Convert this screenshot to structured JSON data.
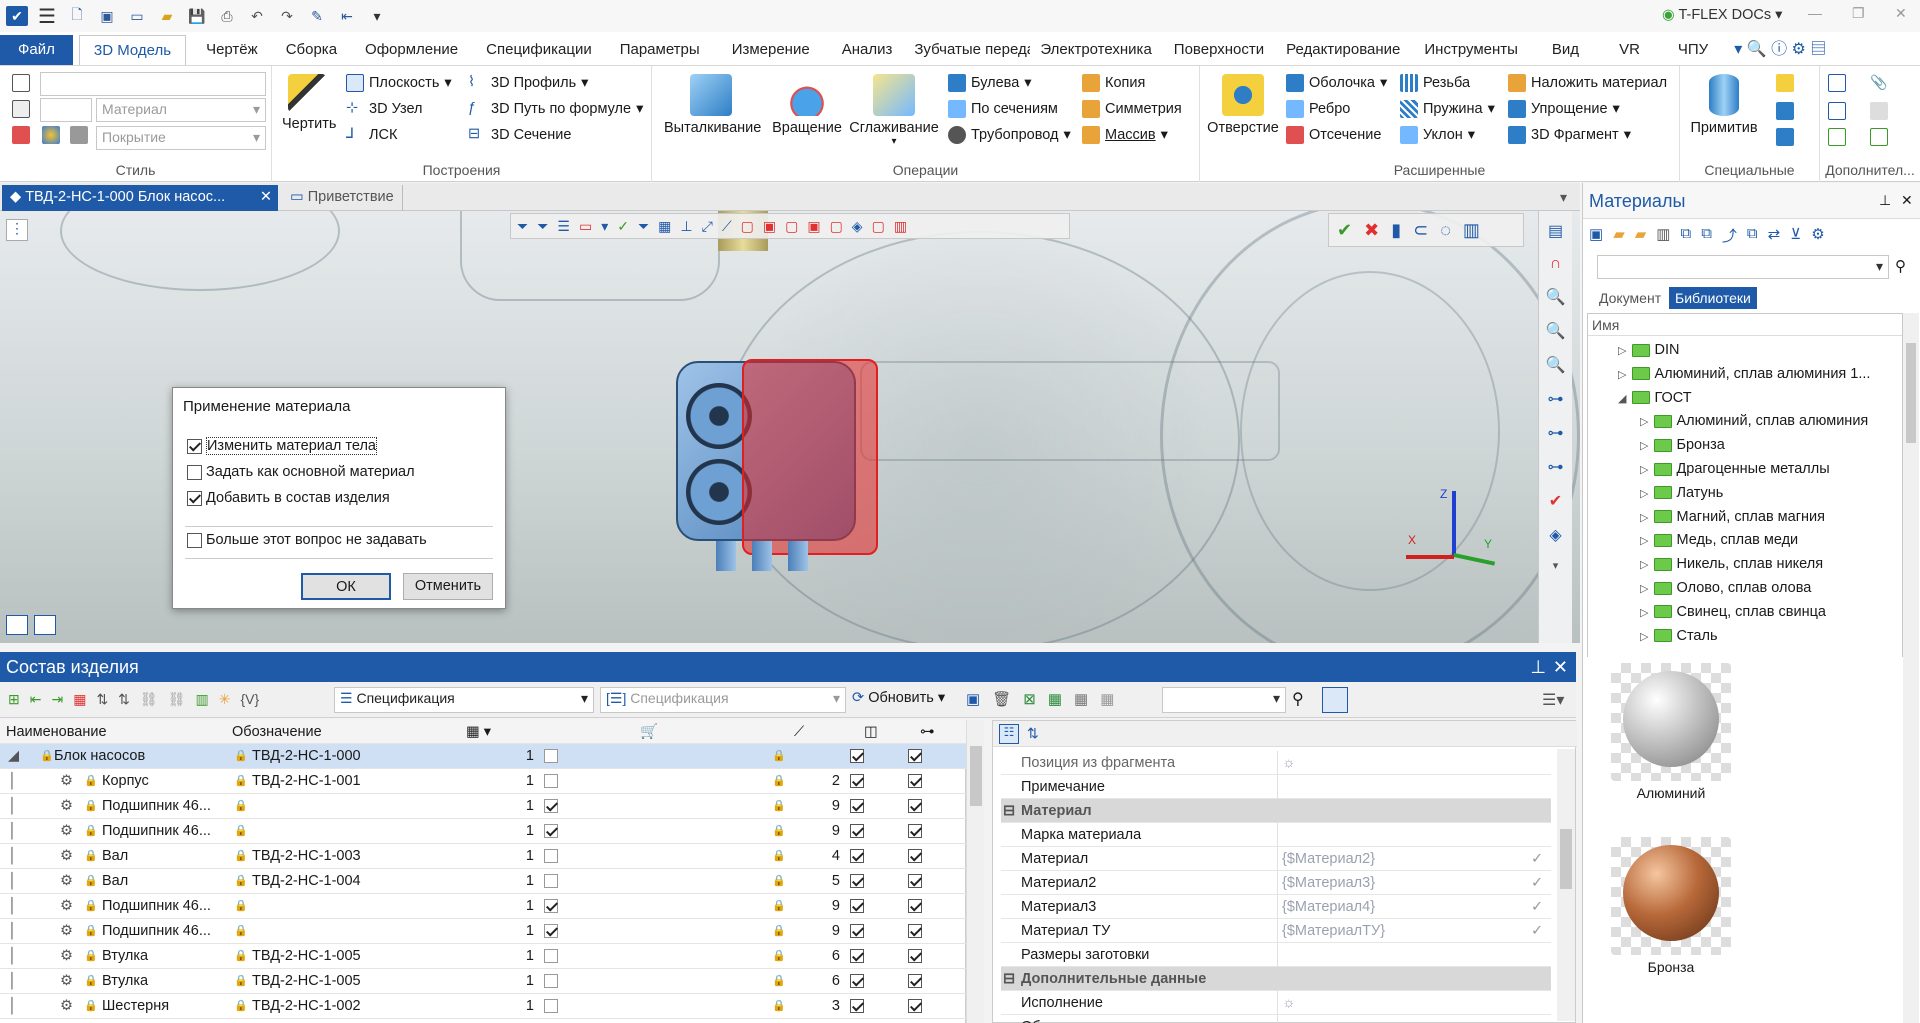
{
  "app": {
    "brand": "T-FLEX DOCs"
  },
  "menu": {
    "tabs": [
      "Файл",
      "3D Модель",
      "Чертёж",
      "Сборка",
      "Оформление",
      "Спецификации",
      "Параметры",
      "Измерение",
      "Анализ",
      "Зубчатые переда",
      "Электротехника",
      "Поверхности",
      "Редактирование",
      "Инструменты",
      "Вид",
      "VR",
      "ЧПУ"
    ]
  },
  "ribbon": {
    "style": {
      "label": "Стиль",
      "material": "Материал",
      "coating": "Покрытие"
    },
    "build": {
      "label": "Построения",
      "draw": "Чертить",
      "plane": "Плоскость",
      "node": "3D Узел",
      "lcs": "ЛСК",
      "profile": "3D Профиль",
      "path": "3D Путь по формуле",
      "section": "3D Сечение"
    },
    "ops": {
      "label": "Операции",
      "extrude": "Выталкивание",
      "rotate": "Вращение",
      "smooth": "Сглаживание",
      "boolean": "Булева",
      "bysections": "По сечениям",
      "pipe": "Трубопровод",
      "copy": "Копия",
      "symmetry": "Симметрия",
      "array": "Массив"
    },
    "ext": {
      "label": "Расширенные",
      "hole": "Отверстие",
      "shell": "Оболочка",
      "rib": "Ребро",
      "cut": "Отсечение",
      "thread": "Резьба",
      "spring": "Пружина",
      "slope": "Уклон",
      "applymat": "Наложить материал",
      "simplify": "Упрощение",
      "fragment": "3D Фрагмент"
    },
    "special": {
      "label": "Специальные",
      "primitive": "Примитив"
    },
    "extra": {
      "label": "Дополнител..."
    }
  },
  "doctabs": {
    "active": "ТВД-2-НС-1-000 Блок насос...",
    "welcome": "Приветствие"
  },
  "dialog": {
    "title": "Применение материала",
    "opt1": "Изменить материал тела",
    "opt2": "Задать как основной материал",
    "opt3": "Добавить в состав изделия",
    "opt4": "Больше этот вопрос не задавать",
    "ok": "ОК",
    "cancel": "Отменить"
  },
  "axes": {
    "x": "X",
    "y": "Y",
    "z": "Z"
  },
  "product": {
    "title": "Состав изделия",
    "spec_select": "Спецификация",
    "spec_placeholder": "Спецификация",
    "refresh": "Обновить",
    "col_name": "Наименование",
    "col_designation": "Обозначение",
    "rows": [
      {
        "name": "Блок насосов",
        "des": "ТВД-2-НС-1-000",
        "qty": "1",
        "pos": "",
        "c1": false
      },
      {
        "name": "Корпус",
        "des": "ТВД-2-НС-1-001",
        "qty": "1",
        "pos": "2",
        "c1": false
      },
      {
        "name": "Подшипник 46...",
        "des": "",
        "qty": "1",
        "pos": "9",
        "c1": true
      },
      {
        "name": "Подшипник 46...",
        "des": "",
        "qty": "1",
        "pos": "9",
        "c1": true
      },
      {
        "name": "Вал",
        "des": "ТВД-2-НС-1-003",
        "qty": "1",
        "pos": "4",
        "c1": false
      },
      {
        "name": "Вал",
        "des": "ТВД-2-НС-1-004",
        "qty": "1",
        "pos": "5",
        "c1": false
      },
      {
        "name": "Подшипник 46...",
        "des": "",
        "qty": "1",
        "pos": "9",
        "c1": true
      },
      {
        "name": "Подшипник 46...",
        "des": "",
        "qty": "1",
        "pos": "9",
        "c1": true
      },
      {
        "name": "Втулка",
        "des": "ТВД-2-НС-1-005",
        "qty": "1",
        "pos": "6",
        "c1": false
      },
      {
        "name": "Втулка",
        "des": "ТВД-2-НС-1-005",
        "qty": "1",
        "pos": "6",
        "c1": false
      },
      {
        "name": "Шестерня",
        "des": "ТВД-2-НС-1-002",
        "qty": "1",
        "pos": "3",
        "c1": false
      }
    ]
  },
  "props": {
    "rows": [
      {
        "k": "Позиция из фрагмента",
        "v": "☼",
        "type": "row"
      },
      {
        "k": "Примечание",
        "v": "",
        "type": "row"
      },
      {
        "k": "Материал",
        "v": "",
        "type": "section"
      },
      {
        "k": "Марка материала",
        "v": "",
        "type": "row"
      },
      {
        "k": "Материал",
        "v": "{$Материал2}",
        "type": "row"
      },
      {
        "k": "Материал2",
        "v": "{$Материал3}",
        "type": "row"
      },
      {
        "k": "Материал3",
        "v": "{$Материал4}",
        "type": "row"
      },
      {
        "k": "Материал ТУ",
        "v": "{$МатериалТУ}",
        "type": "row"
      },
      {
        "k": "Размеры заготовки",
        "v": "",
        "type": "row"
      },
      {
        "k": "Дополнительные данные",
        "v": "",
        "type": "section"
      },
      {
        "k": "Исполнение",
        "v": "☼",
        "type": "row"
      },
      {
        "k": "Обозначение документа на поставку",
        "v": "",
        "type": "row"
      }
    ]
  },
  "materials": {
    "title": "Материалы",
    "tab_doc": "Документ",
    "tab_lib": "Библиотеки",
    "col_name": "Имя",
    "tree": [
      {
        "label": "DIN",
        "level": 1
      },
      {
        "label": "Алюминий, сплав алюминия 1...",
        "level": 1
      },
      {
        "label": "ГОСТ",
        "level": 1
      },
      {
        "label": "Алюминий, сплав алюминия",
        "level": 2
      },
      {
        "label": "Бронза",
        "level": 2
      },
      {
        "label": "Драгоценные металлы",
        "level": 2
      },
      {
        "label": "Латунь",
        "level": 2
      },
      {
        "label": "Магний, сплав магния",
        "level": 2
      },
      {
        "label": "Медь, сплав меди",
        "level": 2
      },
      {
        "label": "Никель, сплав никеля",
        "level": 2
      },
      {
        "label": "Олово, сплав олова",
        "level": 2
      },
      {
        "label": "Свинец, сплав свинца",
        "level": 2
      },
      {
        "label": "Сталь",
        "level": 2
      }
    ],
    "previews": [
      "Алюминий",
      "Бронза"
    ]
  }
}
